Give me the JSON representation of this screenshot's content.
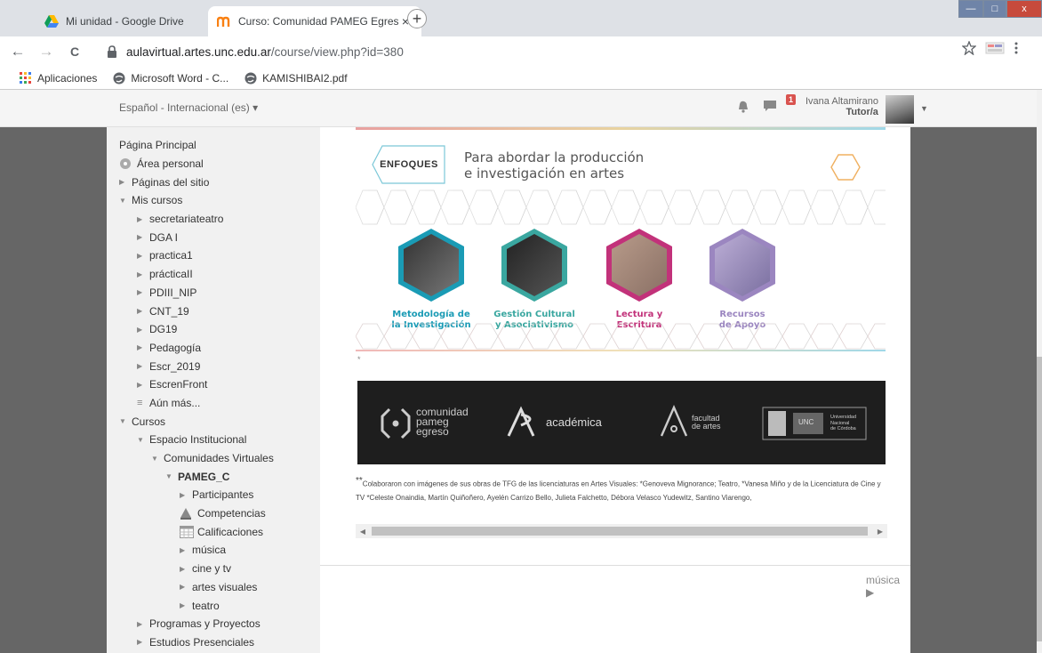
{
  "browser": {
    "tabs": [
      {
        "title": "Mi unidad - Google Drive",
        "close": "×"
      },
      {
        "title": "Curso: Comunidad PAMEG Egres",
        "close": "×"
      }
    ],
    "new_tab": "+",
    "window_controls": {
      "minimize": "—",
      "maximize": "□",
      "close": "x"
    },
    "nav": {
      "back": "←",
      "forward": "→",
      "reload": "C"
    },
    "url_domain": "aulavirtual.artes.unc.edu.ar",
    "url_path": "/course/view.php?id=380",
    "bookmarks": [
      {
        "label": "Aplicaciones",
        "icon": "apps-grid-icon"
      },
      {
        "label": "Microsoft Word - C...",
        "icon": "globe-icon"
      },
      {
        "label": "KAMISHIBAI2.pdf",
        "icon": "globe-icon"
      }
    ]
  },
  "navbar": {
    "language": "Español - Internacional (es) ▾",
    "messages_badge": "1",
    "user_name": "Ivana Altamirano",
    "user_role": "Tutor/a"
  },
  "sidebar": {
    "items": [
      {
        "label": "Página Principal",
        "level": 0,
        "icon": "none"
      },
      {
        "label": "Área personal",
        "level": 0,
        "icon": "dashboard-icon"
      },
      {
        "label": "Páginas del sitio",
        "level": 0,
        "icon": "arrow-right"
      },
      {
        "label": "Mis cursos",
        "level": 0,
        "icon": "arrow-down"
      },
      {
        "label": "secretariateatro",
        "level": 2,
        "icon": "arrow-right"
      },
      {
        "label": "DGA I",
        "level": 2,
        "icon": "arrow-right"
      },
      {
        "label": "practica1",
        "level": 2,
        "icon": "arrow-right"
      },
      {
        "label": "prácticaII",
        "level": 2,
        "icon": "arrow-right"
      },
      {
        "label": "PDIII_NIP",
        "level": 2,
        "icon": "arrow-right"
      },
      {
        "label": "CNT_19",
        "level": 2,
        "icon": "arrow-right"
      },
      {
        "label": "DG19",
        "level": 2,
        "icon": "arrow-right"
      },
      {
        "label": "Pedagogía",
        "level": 2,
        "icon": "arrow-right"
      },
      {
        "label": "Escr_2019",
        "level": 2,
        "icon": "arrow-right"
      },
      {
        "label": "EscrenFront",
        "level": 2,
        "icon": "arrow-right"
      },
      {
        "label": "Aún más...",
        "level": 2,
        "icon": "list"
      },
      {
        "label": "Cursos",
        "level": 0,
        "icon": "arrow-down"
      },
      {
        "label": "Espacio Institucional",
        "level": 2,
        "icon": "arrow-down"
      },
      {
        "label": "Comunidades Virtuales",
        "level": 3,
        "icon": "arrow-down"
      },
      {
        "label": "PAMEG_C",
        "level": 4,
        "icon": "arrow-down",
        "bold": true
      },
      {
        "label": "Participantes",
        "level": 5,
        "icon": "arrow-right"
      },
      {
        "label": "Competencias",
        "level": 5,
        "icon": "competencies-icon"
      },
      {
        "label": "Calificaciones",
        "level": 5,
        "icon": "grades-icon"
      },
      {
        "label": "música",
        "level": 5,
        "icon": "arrow-right"
      },
      {
        "label": "cine y tv",
        "level": 5,
        "icon": "arrow-right"
      },
      {
        "label": "artes visuales",
        "level": 5,
        "icon": "arrow-right"
      },
      {
        "label": "teatro",
        "level": 5,
        "icon": "arrow-right"
      },
      {
        "label": "Programas y Proyectos",
        "level": 2,
        "icon": "arrow-right"
      },
      {
        "label": "Estudios Presenciales",
        "level": 2,
        "icon": "arrow-right"
      }
    ]
  },
  "content": {
    "enfoques_label": "ENFOQUES",
    "enfoques_line1": "Para abordar la producción",
    "enfoques_line2": "e investigación en artes",
    "tiles": [
      {
        "line1": "Metodología de",
        "line2": "la Investigación",
        "color": "#1a9bb5"
      },
      {
        "line1": "Gestión Cultural",
        "line2": "y Asociativismo",
        "color": "#3aa7a0"
      },
      {
        "line1": "Lectura y",
        "line2": "Escritura",
        "color": "#c2327a"
      },
      {
        "line1": "Recursos",
        "line2": "de Apoyo",
        "color": "#9b86c0"
      }
    ],
    "star": "*",
    "footer": {
      "comunidad_1": "comunidad",
      "comunidad_2": "pameg",
      "comunidad_3": "egreso",
      "academica": "académica",
      "facultad_1": "facultad",
      "facultad_2": "de artes",
      "unc": "UNC",
      "universidad_1": "Universidad",
      "universidad_2": "Nacional",
      "universidad_3": "de Córdoba"
    },
    "credits_mark": "**",
    "credits_text": "Colaboraron con imágenes de sus obras de TFG  de las licenciaturas en Artes Visuales: *Genoveva Mignorance;  Teatro, *Vanesa Miño y de la Licenciatura de Cine y TV *Celeste Onaindia, Martín Quiñoñero, Ayelén Carrizo Bello, Julieta Falchetto, Débora Velasco Yudewitz, Santino Viarengo,",
    "next_link": "música ▶",
    "scroll_left": "◀",
    "scroll_right": "▶"
  },
  "colors": {
    "tab_strip": "#dee1e6",
    "sidebar_dark": "#666666",
    "footer_bg": "#1e1e1e",
    "badge": "#d9534f"
  }
}
